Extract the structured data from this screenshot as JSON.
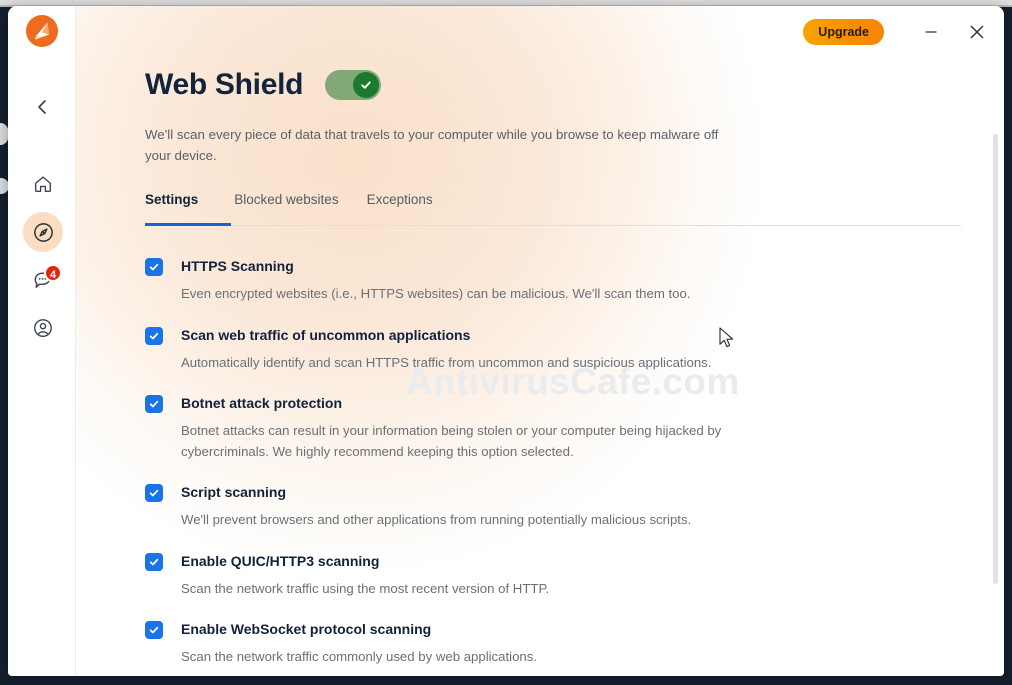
{
  "app": {
    "brand_icon": "avast-logo-icon",
    "window_controls": {
      "upgrade_label": "Upgrade",
      "minimize_icon": "minimize-icon",
      "close_icon": "close-icon"
    }
  },
  "sidebar": {
    "back_icon": "chevron-left-icon",
    "items": [
      {
        "id": "home",
        "icon": "home-icon",
        "active": false,
        "badge": null
      },
      {
        "id": "protection",
        "icon": "compass-icon",
        "active": true,
        "badge": null
      },
      {
        "id": "messages",
        "icon": "chat-bubble-icon",
        "active": false,
        "badge": "4"
      },
      {
        "id": "account",
        "icon": "user-circle-icon",
        "active": false,
        "badge": null
      }
    ],
    "messages_badge": "4"
  },
  "page": {
    "title": "Web Shield",
    "toggle_state": "on",
    "toggle_icon": "check-icon",
    "description": "We'll scan every piece of data that travels to your computer while you browse to keep malware off your device."
  },
  "tabs": [
    {
      "label": "Settings",
      "active": true
    },
    {
      "label": "Blocked websites",
      "active": false
    },
    {
      "label": "Exceptions",
      "active": false
    }
  ],
  "settings": [
    {
      "label": "HTTPS Scanning",
      "checked": true,
      "description": "Even encrypted websites (i.e., HTTPS websites) can be malicious. We'll scan them too."
    },
    {
      "label": "Scan web traffic of uncommon applications",
      "checked": true,
      "description": "Automatically identify and scan HTTPS traffic from uncommon and suspicious applications."
    },
    {
      "label": "Botnet attack protection",
      "checked": true,
      "description": "Botnet attacks can result in your information being stolen or your computer being hijacked by cybercriminals. We highly recommend keeping this option selected."
    },
    {
      "label": "Script scanning",
      "checked": true,
      "description": "We'll prevent browsers and other applications from running potentially malicious scripts."
    },
    {
      "label": "Enable QUIC/HTTP3 scanning",
      "checked": true,
      "description": "Scan the network traffic using the most recent version of HTTP."
    },
    {
      "label": "Enable WebSocket protocol scanning",
      "checked": true,
      "description": "Scan the network traffic commonly used by web applications."
    }
  ],
  "watermark": "AntivirusCafe.com",
  "colors": {
    "accent_blue": "#1a73e8",
    "tab_underline": "#1267d4",
    "toggle_track": "#82a877",
    "toggle_knob": "#1a7a2e",
    "badge_red": "#e8250c",
    "upgrade_orange": "#f79100",
    "title_navy": "#12243c",
    "wash_peach": "#fbe6d4",
    "desktop_navy": "#15202e"
  }
}
